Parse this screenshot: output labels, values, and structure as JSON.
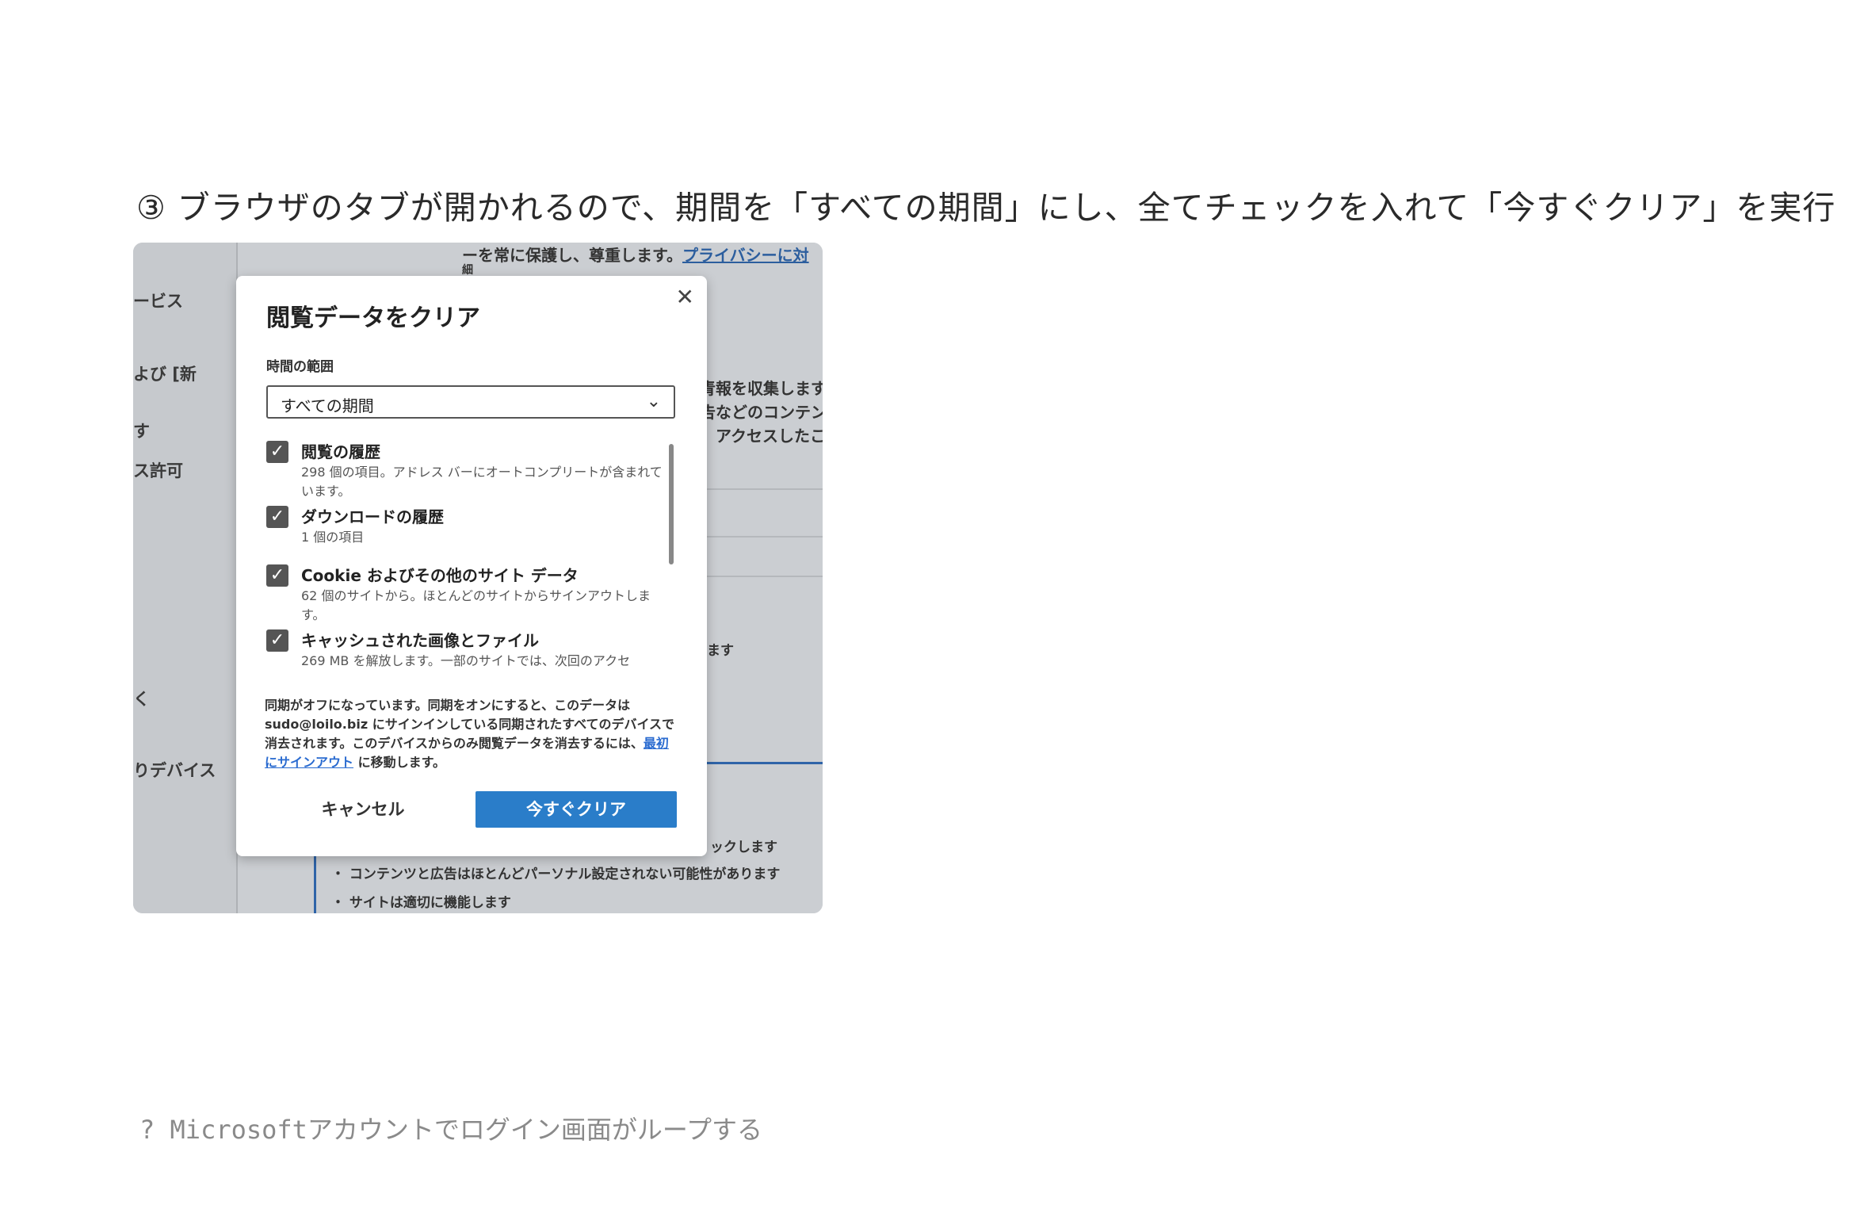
{
  "step_title": "③ ブラウザのタブが開かれるので、期間を「すべての期間」にし、全てチェックを入れて「今すぐクリア」を実行",
  "background": {
    "sidebar_items": [
      "ービス",
      "よび [新",
      "す",
      "ス許可",
      "く",
      "りデバイス"
    ],
    "top_text": "ーを常に保護し、尊重します。",
    "top_link": "プライバシーに対",
    "top_text2": "細",
    "right_lines": [
      "青報を収集します",
      "告などのコンテン",
      "、アクセスしたこ"
    ],
    "right_line_4": "ます",
    "bottom_lines": [
      "ックします",
      "・ コンテンツと広告はほとんどパーソナル設定されない可能性があります",
      "・ サイトは適切に機能します"
    ]
  },
  "dialog": {
    "title": "閲覧データをクリア",
    "close_icon": "close-icon",
    "range_label": "時間の範囲",
    "range_value": "すべての期間",
    "items": [
      {
        "title": "閲覧の履歴",
        "desc": "298 個の項目。アドレス バーにオートコンプリートが含まれています。",
        "checked": true
      },
      {
        "title": "ダウンロードの履歴",
        "desc": "1 個の項目",
        "checked": true
      },
      {
        "title": "Cookie およびその他のサイト データ",
        "desc": "62 個のサイトから。ほとんどのサイトからサインアウトします。",
        "checked": true
      },
      {
        "title": "キャッシュされた画像とファイル",
        "desc": "269 MB を解放します。一部のサイトでは、次回のアクセ",
        "checked": true
      }
    ],
    "sync_note_before": "同期がオフになっています。同期をオンにすると、このデータは sudo@loilo.biz にサインインしている同期されたすべてのデバイスで消去されます。このデバイスからのみ閲覧データを消去するには、",
    "sync_note_link": "最初にサインアウト",
    "sync_note_after": " に移動します。",
    "cancel_label": "キャンセル",
    "clear_label": "今すぐクリア"
  },
  "footer_text": "? Microsoftアカウントでログイン画面がループする"
}
